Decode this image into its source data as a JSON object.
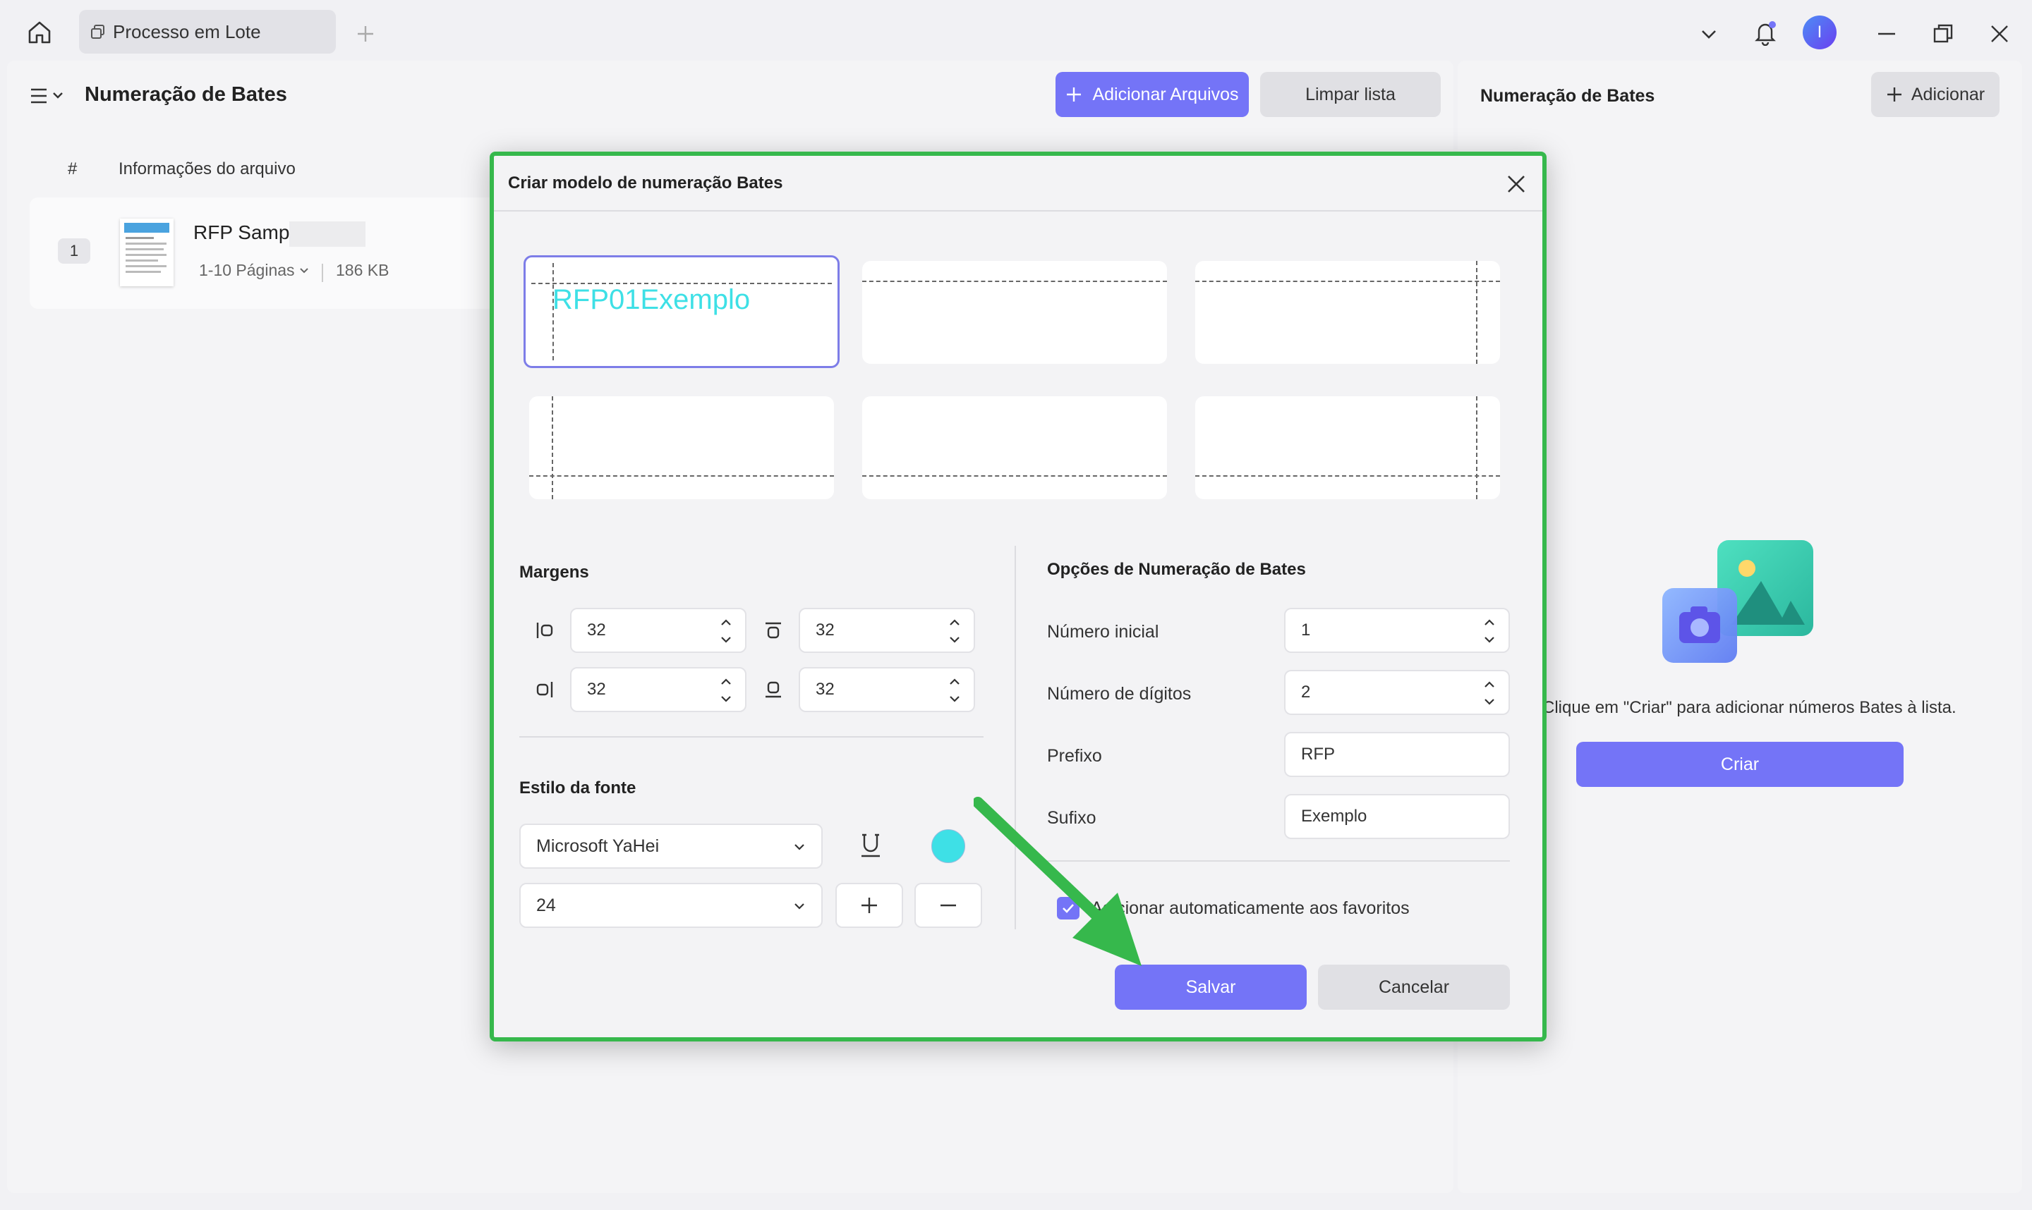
{
  "titlebar": {
    "tab_label": "Processo em Lote",
    "avatar_letter": "I"
  },
  "header": {
    "page_title": "Numeração de Bates",
    "add_files_label": "Adicionar Arquivos",
    "clear_list_label": "Limpar lista"
  },
  "file_list": {
    "col_index": "#",
    "col_info": "Informações do arquivo",
    "files": [
      {
        "index": "1",
        "name": "RFP Sample",
        "pages": "1-10 Páginas",
        "size": "186 KB"
      }
    ]
  },
  "right_panel": {
    "title": "Numeração de Bates",
    "add_label": "Adicionar",
    "empty_message": "Clique em \"Criar\" para adicionar números Bates à lista.",
    "create_label": "Criar"
  },
  "dialog": {
    "title": "Criar modelo de numeração Bates",
    "preview_text": "RFP01Exemplo",
    "margins": {
      "title": "Margens",
      "left": "32",
      "top": "32",
      "right": "32",
      "bottom": "32"
    },
    "font": {
      "title": "Estilo da fonte",
      "family": "Microsoft YaHei",
      "size": "24",
      "color": "#3ee0e6"
    },
    "options": {
      "title": "Opções de Numeração de Bates",
      "start_label": "Número inicial",
      "start_value": "1",
      "digits_label": "Número de dígitos",
      "digits_value": "2",
      "prefix_label": "Prefixo",
      "prefix_value": "RFP",
      "suffix_label": "Sufixo",
      "suffix_value": "Exemplo",
      "favorites_label": "Adicionar automaticamente aos favoritos",
      "favorites_checked": true
    },
    "save_label": "Salvar",
    "cancel_label": "Cancelar"
  },
  "colors": {
    "accent": "#7474f7",
    "highlight_border": "#36b84c",
    "preview_text": "#3ee0e6"
  }
}
